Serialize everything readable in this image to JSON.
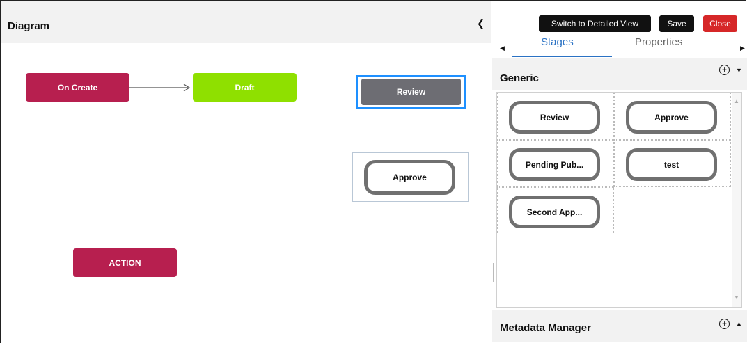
{
  "diagram": {
    "title": "Diagram",
    "collapse_icon": "chevron-left-icon",
    "nodes": {
      "on_create": "On Create",
      "draft": "Draft",
      "review": "Review",
      "approve": "Approve",
      "action": "ACTION"
    },
    "colors": {
      "crimson": "#b71f4f",
      "lime": "#8fe000",
      "gray": "#6d6d73",
      "selection": "#1e90ff"
    }
  },
  "toolbar": {
    "switch_label": "Switch to Detailed View",
    "save_label": "Save",
    "close_label": "Close",
    "close_color": "#d62728"
  },
  "tabs": [
    {
      "label": "Stages",
      "active": true
    },
    {
      "label": "Properties",
      "active": false
    }
  ],
  "generic": {
    "title": "Generic",
    "stages": [
      "Review",
      "Approve",
      "Pending Pub...",
      "test",
      "Second App..."
    ]
  },
  "metadata": {
    "title": "Metadata Manager"
  }
}
